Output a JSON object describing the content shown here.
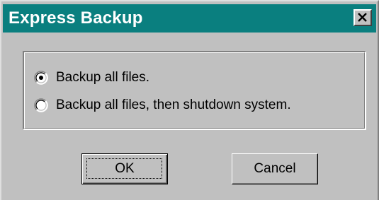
{
  "window": {
    "title": "Express Backup",
    "close_icon": "close-x-icon"
  },
  "options": [
    {
      "label": "Backup all files.",
      "selected": true
    },
    {
      "label": "Backup all files, then shutdown system.",
      "selected": false
    }
  ],
  "buttons": {
    "ok_label": "OK",
    "cancel_label": "Cancel"
  },
  "colors": {
    "titlebar": "#0a7f7f",
    "dialog_face": "#c0c0c0",
    "title_text": "#ffffff"
  }
}
